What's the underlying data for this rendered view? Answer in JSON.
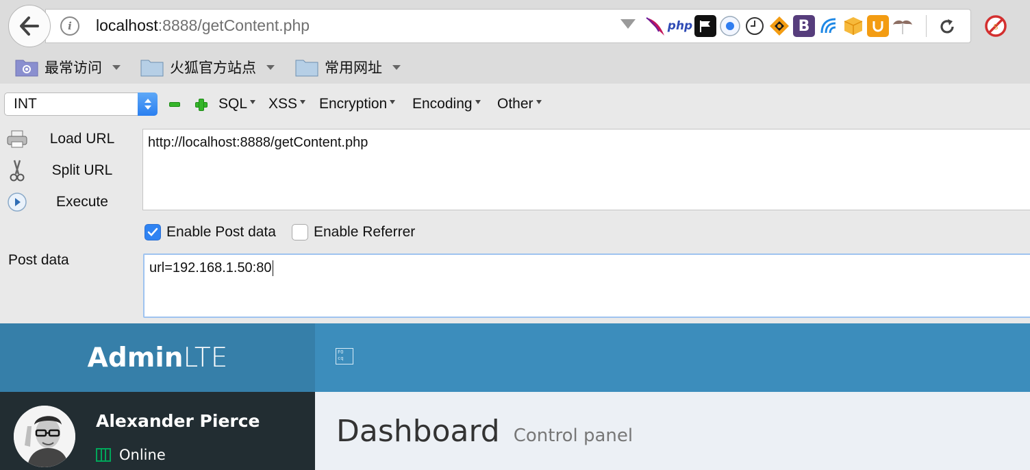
{
  "browser": {
    "url_host": "localhost",
    "url_rest": ":8888/getContent.php",
    "extensions": [
      "apache-feather-icon",
      "php-icon",
      "flag-icon",
      "record-icon",
      "clock-icon",
      "fox-icon",
      "bootstrap-icon",
      "wave-icon",
      "box-icon",
      "shield-u-icon",
      "mustache-icon"
    ],
    "php_label": "php",
    "bootstrap_label": "B"
  },
  "bookmarks": [
    {
      "label": "最常访问"
    },
    {
      "label": "火狐官方站点"
    },
    {
      "label": "常用网址"
    }
  ],
  "hackbar": {
    "select_value": "INT",
    "menus": [
      "SQL",
      "XSS",
      "Encryption",
      "Encoding",
      "Other"
    ],
    "load_url": "Load URL",
    "split_url": "Split URL",
    "execute": "Execute",
    "url_value": "http://localhost:8888/getContent.php",
    "enable_post": "Enable Post data",
    "enable_post_checked": true,
    "enable_referrer": "Enable Referrer",
    "enable_referrer_checked": false,
    "post_label": "Post data",
    "post_value": "url=192.168.1.50:80"
  },
  "admin": {
    "logo_bold": "Admin",
    "logo_light": "LTE",
    "user_name": "Alexander Pierce",
    "status": "Online",
    "page_title": "Dashboard",
    "page_subtitle": "Control panel",
    "colors": {
      "header": "#3c8dbc",
      "logo": "#367fa9",
      "sidebar": "#222d32",
      "online": "#00a65a"
    }
  }
}
